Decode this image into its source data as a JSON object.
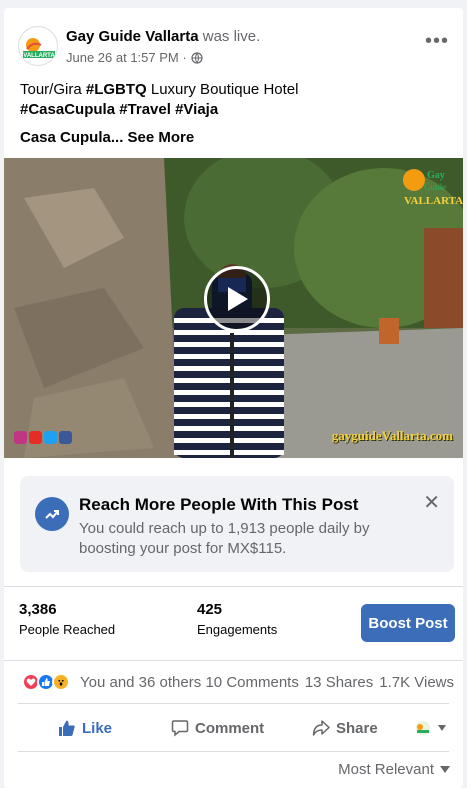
{
  "post": {
    "page_name": "Gay Guide Vallarta",
    "live_suffix": "was live.",
    "date": "June 26 at 1:57 PM ·",
    "text_line1_plain": "Tour/Gira ",
    "text_line1_tag": "#LGBTQ",
    "text_line1_rest": " Luxury Boutique Hotel",
    "text_line2": "#CasaCupula #Travel #Viaja",
    "see_more": "Casa Cupula... See More",
    "watermark": "gayguideVallarta.com",
    "logo_icon": "gay-guide-vallarta-logo"
  },
  "boost_card": {
    "title": "Reach More People With This Post",
    "description": "You could reach up to 1,913 people daily by boosting your post for MX$115.",
    "close_icon": "close-icon",
    "icon": "trend-up-icon"
  },
  "stats": {
    "reached_value": "3,386",
    "reached_label": "People Reached",
    "engagements_value": "425",
    "engagements_label": "Engagements",
    "boost_button": "Boost Post"
  },
  "reactions": {
    "summary": "You and 36 others",
    "comments": "10 Comments",
    "shares": "13 Shares",
    "views": "1.7K Views"
  },
  "actions": {
    "like": "Like",
    "comment": "Comment",
    "share": "Share"
  },
  "sort": {
    "label": "Most Relevant"
  },
  "colors": {
    "accent": "#3b6db8",
    "secondary_text": "#65676b",
    "divider": "#dadde1"
  }
}
